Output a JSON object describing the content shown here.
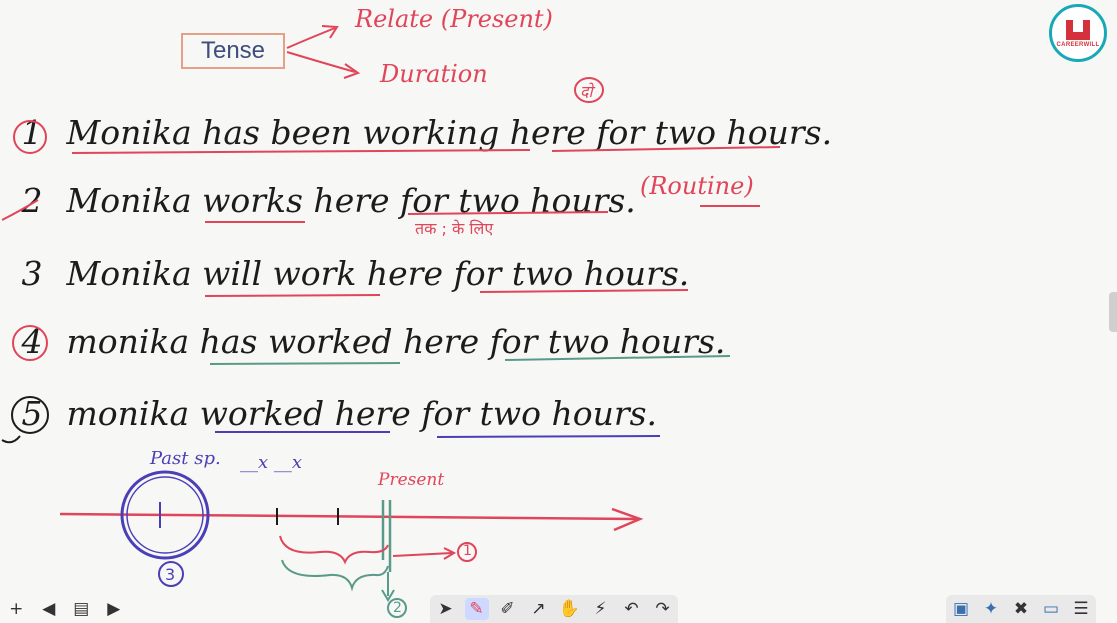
{
  "logo": {
    "word": "CAREERWILL"
  },
  "heading": {
    "tense": "Tense",
    "relate": "Relate (Present)",
    "duration": "Duration",
    "note": "दो"
  },
  "sentences": [
    {
      "num": "1",
      "text": "Monika has been working here for two hours."
    },
    {
      "num": "2",
      "text": "Monika works here for two hours.",
      "tag": "(Routine)",
      "hindi": "तक ; के लिए"
    },
    {
      "num": "3",
      "text": "Monika will work here for two hours."
    },
    {
      "num": "4",
      "text": "monika has worked here for two hours."
    },
    {
      "num": "5",
      "text": "monika worked here for two hours."
    }
  ],
  "timeline": {
    "past_label": "Past sp.",
    "marks": "__x __x",
    "present_label": "Present",
    "circle_num": "3",
    "branch_1": "1",
    "branch_2": "2"
  },
  "toolbar": {
    "tools": [
      {
        "name": "select-tool-icon",
        "glyph": "➤"
      },
      {
        "name": "pen-tool-icon",
        "glyph": "✎",
        "active": true
      },
      {
        "name": "highlighter-tool-icon",
        "glyph": "✐"
      },
      {
        "name": "arrow-tool-icon",
        "glyph": "↗"
      },
      {
        "name": "hand-tool-icon",
        "glyph": "✋"
      },
      {
        "name": "laser-tool-icon",
        "glyph": "⚡"
      },
      {
        "name": "undo-icon",
        "glyph": "↶"
      },
      {
        "name": "redo-icon",
        "glyph": "↷"
      }
    ],
    "right_tools": [
      {
        "name": "image-icon",
        "glyph": "▣"
      },
      {
        "name": "shapes-icon",
        "glyph": "✦"
      },
      {
        "name": "tools-icon",
        "glyph": "✖"
      },
      {
        "name": "screen-icon",
        "glyph": "▭"
      },
      {
        "name": "menu-icon",
        "glyph": "☰"
      }
    ],
    "left_tools": [
      {
        "name": "add-icon",
        "glyph": "+"
      },
      {
        "name": "prev-page-icon",
        "glyph": "◀"
      },
      {
        "name": "page-icon",
        "glyph": "▤"
      },
      {
        "name": "next-page-icon",
        "glyph": "▶"
      }
    ]
  },
  "colors": {
    "red": "#e0455a",
    "blue": "#4b3fb8",
    "green": "#5a9a8a",
    "black": "#1c1c1c"
  }
}
